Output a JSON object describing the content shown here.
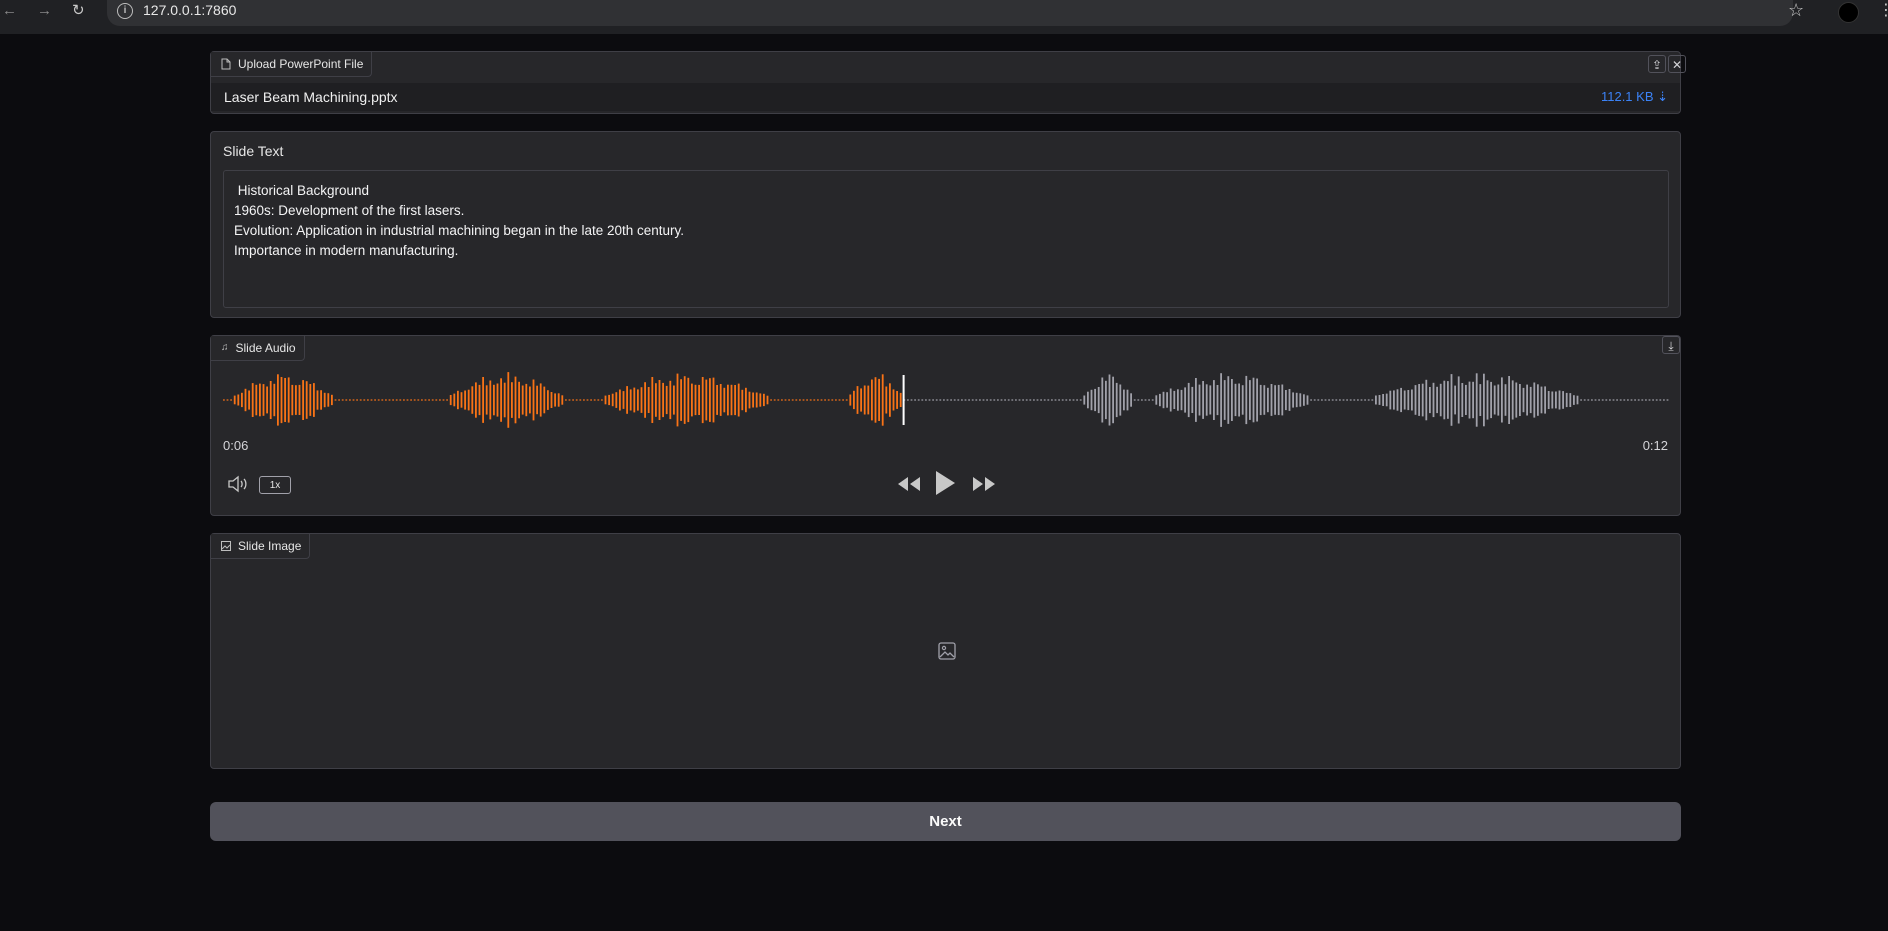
{
  "browser": {
    "back_icon": "←",
    "forward_icon": "→",
    "reload_icon": "↻",
    "info_icon": "i",
    "url": "127.0.0.1:7860",
    "star_icon": "☆",
    "menu_icon": "⋮"
  },
  "file_upload": {
    "label": "Upload PowerPoint File",
    "file_name": "Laser Beam Machining.pptx",
    "file_size": "112.1 KB ⇣",
    "upload_icon": "⇪",
    "clear_icon": "✕"
  },
  "slide_text": {
    "label": "Slide Text",
    "value": " Historical Background\n1960s: Development of the first lasers.\nEvolution: Application in industrial machining began in the late 20th century.\nImportance in modern manufacturing."
  },
  "slide_audio": {
    "label": "Slide Audio",
    "current_time": "0:06",
    "duration": "0:12",
    "playback_speed": "1x",
    "played_fraction": 0.47,
    "played_color": "#f97316",
    "unplayed_color": "#a1a1aa",
    "download_icon": "⤓"
  },
  "slide_image": {
    "label": "Slide Image",
    "placeholder_icon": "image-icon"
  },
  "next_button": {
    "label": "Next"
  }
}
